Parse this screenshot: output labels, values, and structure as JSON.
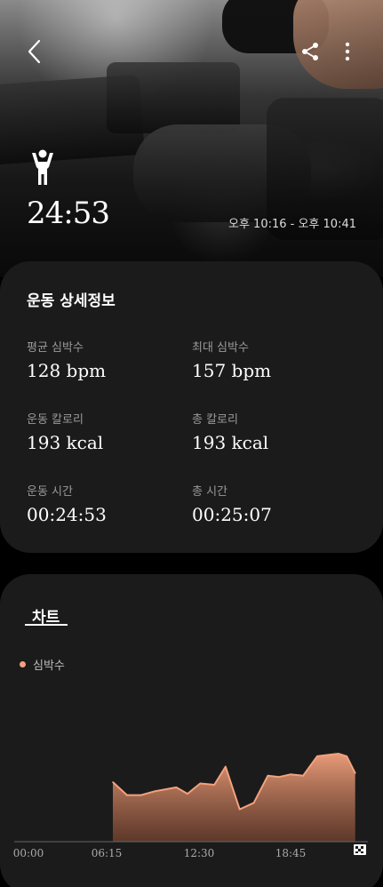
{
  "hero": {
    "duration": "24:53",
    "time_range": "오후 10:16 - 오후 10:41",
    "icons": {
      "back": "chevron-left-icon",
      "share": "share-icon",
      "more": "more-vertical-icon",
      "workout": "weightlifting-icon"
    }
  },
  "details": {
    "title": "운동 상세정보",
    "stats": [
      {
        "label": "평균 심박수",
        "value": "128 bpm"
      },
      {
        "label": "최대 심박수",
        "value": "157 bpm"
      },
      {
        "label": "운동 칼로리",
        "value": "193 kcal"
      },
      {
        "label": "총 칼로리",
        "value": "193 kcal"
      },
      {
        "label": "운동 시간",
        "value": "00:24:53"
      },
      {
        "label": "총 시간",
        "value": "00:25:07"
      }
    ]
  },
  "chart_section": {
    "tab_label": "차트",
    "legend_label": "심박수",
    "accent": "#f2a27d",
    "end_icon": "finish-flag-icon"
  },
  "chart_data": {
    "type": "area",
    "title": "",
    "xlabel": "",
    "ylabel": "",
    "x_tick_labels": [
      "00:00",
      "06:15",
      "12:30",
      "18:45"
    ],
    "x_range_minutes": [
      0,
      25.1
    ],
    "ylim": [
      80,
      170
    ],
    "grid": false,
    "series": [
      {
        "name": "심박수",
        "x": [
          7.0,
          8.0,
          9.0,
          10.0,
          11.5,
          12.3,
          13.2,
          14.2,
          15.0,
          16.0,
          17.0,
          18.0,
          18.8,
          19.6,
          20.5,
          21.5,
          22.2,
          23.0,
          23.6,
          24.2
        ],
        "values": [
          126,
          116,
          116,
          119,
          122,
          117,
          125,
          124,
          138,
          105,
          110,
          131,
          130,
          132,
          131,
          146,
          147,
          148,
          146,
          133
        ]
      }
    ]
  }
}
